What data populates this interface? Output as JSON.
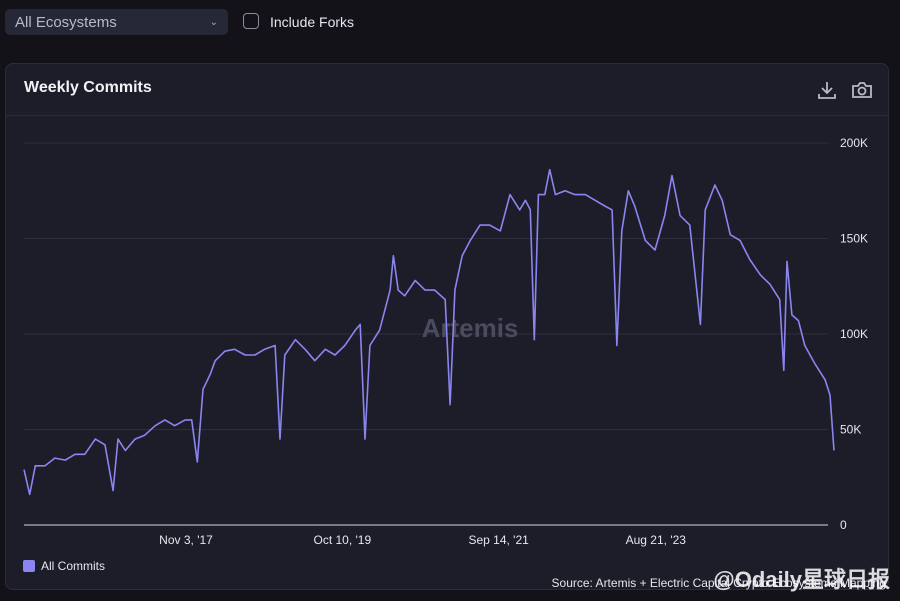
{
  "controls": {
    "ecosystem_select": "All Ecosystems",
    "include_forks_label": "Include Forks",
    "include_forks_checked": false
  },
  "card": {
    "title": "Weekly Commits",
    "legend_label": "All Commits",
    "source": "Source: Artemis + Electric Capital Crypto Ecosystems Mapping",
    "chart_watermark": "Artemis",
    "overlay_watermark": "@Odaily星球日报"
  },
  "colors": {
    "line": "#8b85f0",
    "background": "#1c1d29",
    "grid": "#2c2e3c"
  },
  "chart_data": {
    "type": "line",
    "title": "Weekly Commits",
    "xlabel": "",
    "ylabel": "",
    "ylim": [
      0,
      200000
    ],
    "xlim": [
      2015.84,
      2025.84
    ],
    "y_ticks": [
      {
        "v": 0,
        "label": "0"
      },
      {
        "v": 50000,
        "label": "50K"
      },
      {
        "v": 100000,
        "label": "100K"
      },
      {
        "v": 150000,
        "label": "150K"
      },
      {
        "v": 200000,
        "label": "200K"
      }
    ],
    "x_ticks": [
      {
        "v": 2017.84,
        "label": "Nov 3, '17"
      },
      {
        "v": 2019.77,
        "label": "Oct 10, '19"
      },
      {
        "v": 2021.7,
        "label": "Sep 14, '21"
      },
      {
        "v": 2023.64,
        "label": "Aug 21, '23"
      }
    ],
    "grid": true,
    "legend": "bottom-left",
    "series": [
      {
        "name": "All Commits",
        "x": [
          2015.84,
          2015.91,
          2015.98,
          2016.1,
          2016.22,
          2016.35,
          2016.47,
          2016.59,
          2016.72,
          2016.84,
          2016.94,
          2017.0,
          2017.09,
          2017.21,
          2017.33,
          2017.46,
          2017.58,
          2017.7,
          2017.83,
          2017.91,
          2017.98,
          2018.05,
          2018.14,
          2018.2,
          2018.32,
          2018.44,
          2018.57,
          2018.69,
          2018.81,
          2018.94,
          2019.0,
          2019.06,
          2019.19,
          2019.31,
          2019.43,
          2019.56,
          2019.68,
          2019.8,
          2019.93,
          2019.99,
          2020.05,
          2020.11,
          2020.23,
          2020.36,
          2020.4,
          2020.46,
          2020.54,
          2020.67,
          2020.79,
          2020.91,
          2021.04,
          2021.1,
          2021.16,
          2021.25,
          2021.35,
          2021.47,
          2021.59,
          2021.72,
          2021.84,
          2021.96,
          2022.03,
          2022.09,
          2022.14,
          2022.19,
          2022.27,
          2022.33,
          2022.4,
          2022.52,
          2022.64,
          2022.77,
          2022.89,
          2023.01,
          2023.1,
          2023.16,
          2023.22,
          2023.3,
          2023.38,
          2023.51,
          2023.63,
          2023.75,
          2023.84,
          2023.94,
          2024.06,
          2024.19,
          2024.25,
          2024.37,
          2024.46,
          2024.56,
          2024.68,
          2024.8,
          2024.93,
          2025.05,
          2025.17,
          2025.22,
          2025.26,
          2025.32,
          2025.4,
          2025.48,
          2025.61,
          2025.73,
          2025.79,
          2025.84
        ],
        "values": [
          29000,
          16000,
          31000,
          31000,
          35000,
          34000,
          37000,
          37000,
          45000,
          42000,
          18000,
          45000,
          39000,
          45000,
          47000,
          52000,
          55000,
          52000,
          55000,
          55000,
          33000,
          71000,
          79000,
          86000,
          91000,
          92000,
          89000,
          89000,
          92000,
          94000,
          45000,
          89000,
          97000,
          92000,
          86000,
          92000,
          89000,
          94000,
          102000,
          105000,
          45000,
          94000,
          102000,
          123000,
          141000,
          123000,
          120000,
          128000,
          123000,
          123000,
          118000,
          63000,
          123000,
          141000,
          149000,
          157000,
          157000,
          154000,
          173000,
          165000,
          170000,
          165000,
          97000,
          173000,
          173000,
          186000,
          173000,
          175000,
          173000,
          173000,
          170000,
          167000,
          165000,
          94000,
          154000,
          175000,
          167000,
          149000,
          144000,
          162000,
          183000,
          162000,
          157000,
          105000,
          165000,
          178000,
          170000,
          152000,
          149000,
          139000,
          131000,
          126000,
          118000,
          81000,
          138000,
          110000,
          107000,
          94000,
          84000,
          76000,
          68000,
          39000
        ]
      }
    ]
  }
}
